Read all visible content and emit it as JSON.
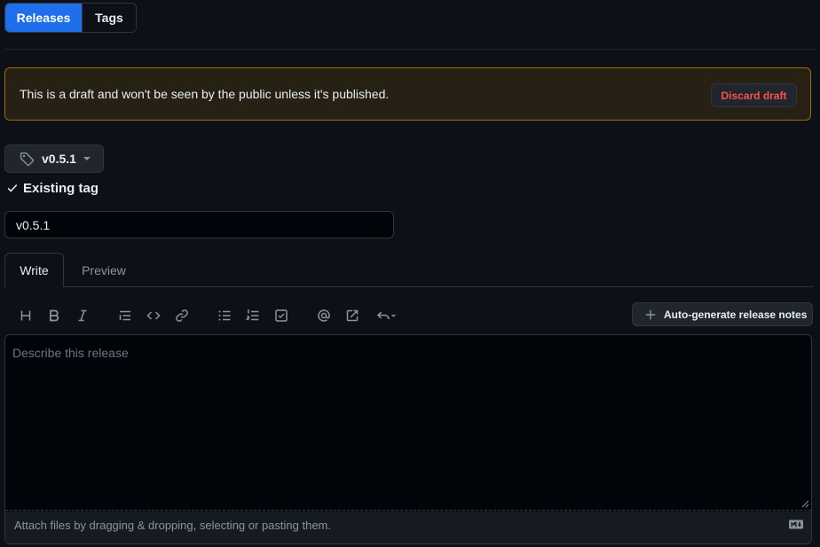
{
  "tabs": {
    "releases": "Releases",
    "tags": "Tags"
  },
  "banner": {
    "message": "This is a draft and won't be seen by the public unless it's published.",
    "discard_label": "Discard draft"
  },
  "tag": {
    "label": "v0.5.1",
    "status": "Existing tag"
  },
  "title_input": {
    "value": "v0.5.1"
  },
  "editor_tabs": {
    "write": "Write",
    "preview": "Preview"
  },
  "toolbar": {
    "items": [
      "heading-icon",
      "bold-icon",
      "italic-icon",
      "quote-icon",
      "code-icon",
      "link-icon",
      "bulleted-list-icon",
      "numbered-list-icon",
      "task-list-icon",
      "mention-icon",
      "cross-reference-icon",
      "saved-replies-icon"
    ],
    "autogen_label": "Auto-generate release notes"
  },
  "description": {
    "placeholder": "Describe this release",
    "attach_text": "Attach files by dragging & dropping, selecting or pasting them."
  },
  "colors": {
    "accent": "#1f6feb",
    "danger": "#f85149",
    "warning_border": "#9e6a03",
    "bg": "#0d1117"
  }
}
